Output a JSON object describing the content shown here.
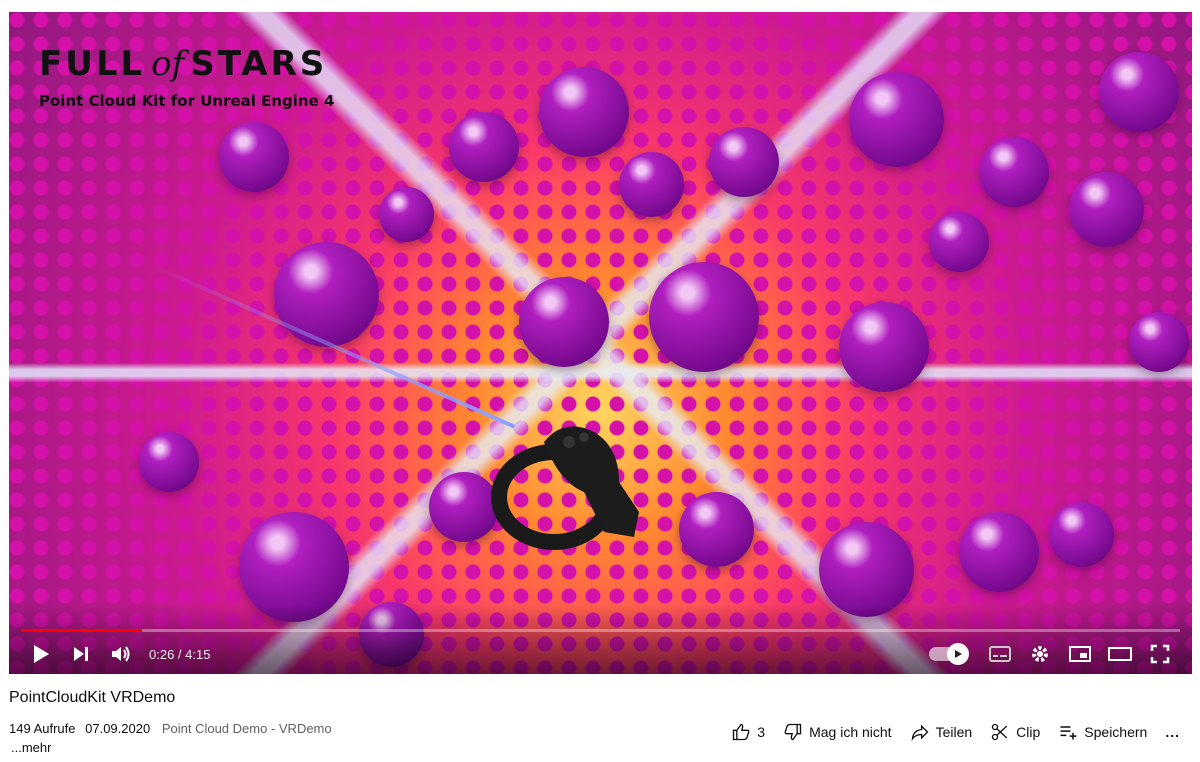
{
  "overlay": {
    "title_part1": "FULL",
    "title_of": "of",
    "title_part2": "STARS",
    "subtitle": "Point Cloud Kit for Unreal Engine 4"
  },
  "player": {
    "progress": 0.104,
    "time": "0:26 / 4:15",
    "autoplay_on": true,
    "icons": [
      "play-icon",
      "next-icon",
      "volume-icon",
      "autoplay-toggle",
      "subtitles-icon",
      "settings-icon",
      "miniplayer-icon",
      "theater-icon",
      "fullscreen-icon"
    ]
  },
  "video": {
    "title": "PointCloudKit VRDemo",
    "views": "149 Aufrufe",
    "date": "07.09.2020",
    "channel_info": "Point Cloud Demo - VRDemo",
    "more": "...mehr"
  },
  "actions": {
    "like_count": "3",
    "dislike_label": "Mag ich nicht",
    "share_label": "Teilen",
    "clip_label": "Clip",
    "save_label": "Speichern",
    "more_label": "..."
  },
  "colors": {
    "progress": "#ff0000",
    "sphere": "#8a0fa6",
    "background_warm": "#ff8a3a"
  }
}
